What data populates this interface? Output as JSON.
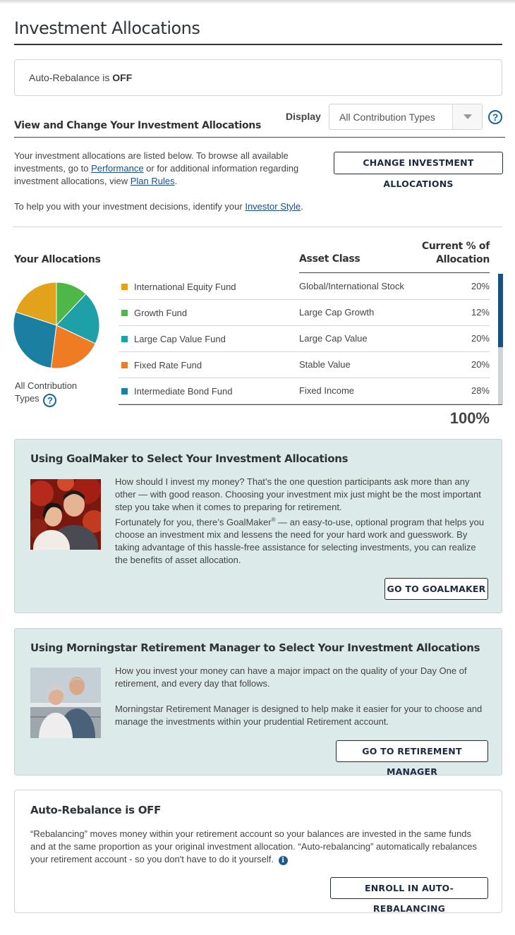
{
  "page": {
    "title": "Investment Allocations"
  },
  "banner": {
    "prefix": "Auto-Rebalance is ",
    "status": "OFF"
  },
  "section": {
    "heading": "View and Change Your Investment Allocations",
    "display_label": "Display",
    "display_value": "All Contribution Types"
  },
  "intro": {
    "t1": "Your investment allocations are listed below. To browse all available investments, go to ",
    "link1": "Performance",
    "t2": " or for additional information regarding investment allocations, view ",
    "link2": "Plan Rules",
    "t3": ".",
    "style_t1": "To help you with your investment decisions, identify your ",
    "style_link": "Investor Style",
    "style_t2": "."
  },
  "buttons": {
    "change": "CHANGE INVESTMENT ALLOCATIONS",
    "goalmaker": "GO TO GOALMAKER",
    "retirement": "GO TO RETIREMENT MANAGER",
    "enroll": "ENROLL IN AUTO-REBALANCING"
  },
  "allocations": {
    "col_yours": "Your Allocations",
    "col_asset": "Asset Class",
    "col_current_1": "Current % of",
    "col_current_2": "Allocation",
    "rows": [
      {
        "fund": "International Equity Fund",
        "asset": "Global/International Stock",
        "pct": "20%",
        "color": "#e3a21b"
      },
      {
        "fund": "Growth Fund",
        "asset": "Large Cap Growth",
        "pct": "12%",
        "color": "#4db848"
      },
      {
        "fund": "Large Cap Value Fund",
        "asset": "Large Cap Value",
        "pct": "20%",
        "color": "#1ea0a8"
      },
      {
        "fund": "Fixed Rate Fund",
        "asset": "Stable Value",
        "pct": "20%",
        "color": "#ef7b22"
      },
      {
        "fund": "Intermediate Bond Fund",
        "asset": "Fixed Income",
        "pct": "28%",
        "color": "#1a7fa0"
      }
    ],
    "total": "100%",
    "caption": "All Contribution Types"
  },
  "goalmaker": {
    "title": "Using GoalMaker to Select Your Investment Allocations",
    "p1": "How should I invest my money? That’s the one question participants ask more than any other — with good reason. Choosing your investment mix just might be the most important step you take when it comes to preparing for retirement.",
    "p2a": "Fortunately for you, there’s GoalMaker",
    "p2reg": "®",
    "p2b": " — an easy-to-use, optional program that helps you choose an investment mix and lessens the need for your hard work and guesswork. By taking advantage of this hassle-free assistance for selecting investments, you can realize the benefits of asset allocation."
  },
  "morningstar": {
    "title": "Using Morningstar Retirement Manager to Select Your Investment Allocations",
    "p1": "How you invest your money can have a major impact on the quality of your Day One of retirement, and every day that follows.",
    "p2": "Morningstar Retirement Manager is designed to help make it easier for your to choose and manage the investments within your prudential Retirement account."
  },
  "autorebalance": {
    "title": "Auto-Rebalance is OFF",
    "text": "“Rebalancing” moves money within your retirement account so your balances are invested in the same funds and at the same proportion as your original investment allocation. “Auto-rebalancing” automatically rebalances your retirement account - so you don't have to do it yourself."
  },
  "icons": {
    "help": "question-circle-icon",
    "info": "info-icon",
    "dropdown": "chevron-down-icon"
  }
}
